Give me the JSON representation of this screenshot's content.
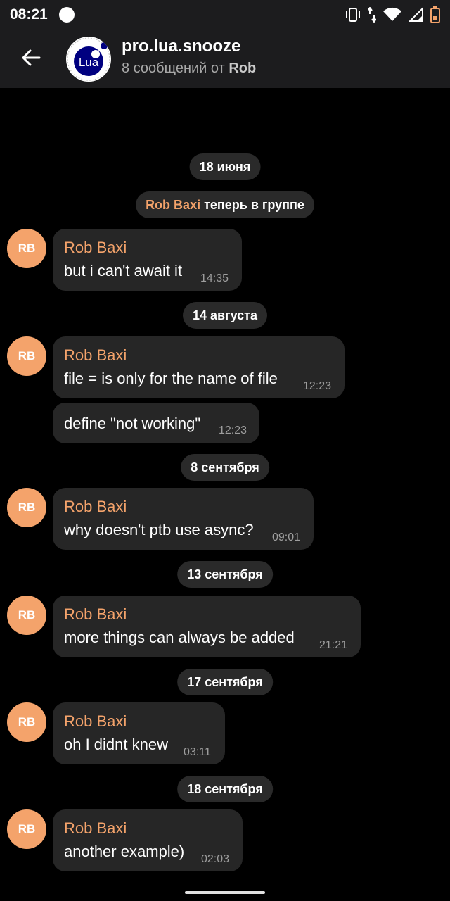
{
  "status_bar": {
    "time": "08:21",
    "icons": [
      "notification-dot-icon",
      "vibrate-icon",
      "data-arrows-icon",
      "wifi-icon",
      "signal-icon",
      "battery-low-icon"
    ],
    "battery_color": "#f4a36b"
  },
  "header": {
    "title": "pro.lua.snooze",
    "subtitle_prefix": "8 сообщений от ",
    "subtitle_name": "Rob",
    "avatar_label": "Lua",
    "avatar_color": "#000080"
  },
  "colors": {
    "accent": "#f4a36b",
    "bubble": "#262626",
    "pill": "#2a2a2a",
    "background": "#000000"
  },
  "dates": [
    "18 июня",
    "14 августа",
    "8 сентября",
    "13 сентября",
    "17 сентября",
    "18 сентября"
  ],
  "service": {
    "name": "Rob Baxi",
    "text": " теперь в группе"
  },
  "messages": [
    {
      "avatar": "RB",
      "sender": "Rob Baxi",
      "text": "but i can't await it",
      "time": "14:35"
    },
    {
      "avatar": "RB",
      "sender": "Rob Baxi",
      "text": "file = is only for the name of file",
      "time": "12:23"
    },
    {
      "text": "define \"not working\"",
      "time": "12:23"
    },
    {
      "avatar": "RB",
      "sender": "Rob Baxi",
      "text": "why doesn't ptb use async?",
      "time": "09:01"
    },
    {
      "avatar": "RB",
      "sender": "Rob Baxi",
      "text": "more things can always be added",
      "time": "21:21"
    },
    {
      "avatar": "RB",
      "sender": "Rob Baxi",
      "text": "oh I didnt knew",
      "time": "03:11"
    },
    {
      "avatar": "RB",
      "sender": "Rob Baxi",
      "text": "another example)",
      "time": "02:03"
    }
  ]
}
